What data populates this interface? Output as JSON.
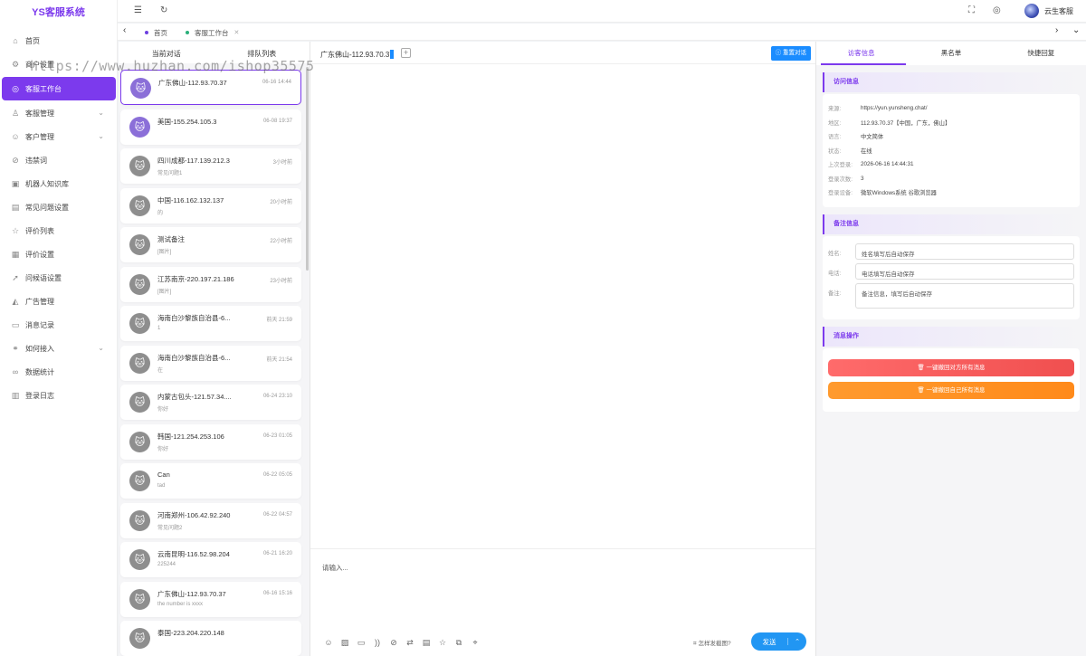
{
  "app": {
    "logo": "YS客服系统"
  },
  "sidebar": {
    "items": [
      {
        "label": "首页",
        "icon": "home-icon",
        "glyph": "⌂"
      },
      {
        "label": "商户设置",
        "icon": "gear-icon",
        "glyph": "⚙"
      },
      {
        "label": "客服工作台",
        "icon": "headset-icon",
        "glyph": "◎",
        "active": true
      },
      {
        "label": "客服管理",
        "icon": "user-icon",
        "glyph": "♙",
        "expandable": true
      },
      {
        "label": "客户管理",
        "icon": "customer-icon",
        "glyph": "☺",
        "expandable": true
      },
      {
        "label": "违禁词",
        "icon": "ban-icon",
        "glyph": "⊘"
      },
      {
        "label": "机器人知识库",
        "icon": "robot-icon",
        "glyph": "▣"
      },
      {
        "label": "常见问题设置",
        "icon": "document-icon",
        "glyph": "▤"
      },
      {
        "label": "评价列表",
        "icon": "rating-icon",
        "glyph": "☆"
      },
      {
        "label": "评价设置",
        "icon": "calendar-icon",
        "glyph": "▦"
      },
      {
        "label": "问候语设置",
        "icon": "send-icon",
        "glyph": "➚"
      },
      {
        "label": "广告管理",
        "icon": "megaphone-icon",
        "glyph": "◭"
      },
      {
        "label": "消息记录",
        "icon": "message-icon",
        "glyph": "▭"
      },
      {
        "label": "如何接入",
        "icon": "link-icon",
        "glyph": "⚭",
        "expandable": true
      },
      {
        "label": "数据统计",
        "icon": "chart-icon",
        "glyph": "∞"
      },
      {
        "label": "登录日志",
        "icon": "log-icon",
        "glyph": "▥"
      }
    ]
  },
  "topbar": {
    "username": "云生客服"
  },
  "tabs": [
    {
      "label": "首页",
      "dot_color": "#6c3fe0"
    },
    {
      "label": "客服工作台",
      "dot_color": "#2ab07a",
      "closable": true
    }
  ],
  "conversations": {
    "tabs": [
      "当前对话",
      "排队列表"
    ],
    "items": [
      {
        "name": "广东佛山-112.93.70.37",
        "time": "06-16 14:44",
        "message": "",
        "active": true,
        "avatar": "purple"
      },
      {
        "name": "美国-155.254.105.3",
        "time": "06-08 19:37",
        "message": "",
        "avatar": "purple"
      },
      {
        "name": "四川成都-117.139.212.3",
        "time": "3小时前",
        "message": "常见问题1",
        "avatar": "gray"
      },
      {
        "name": "中国-116.162.132.137",
        "time": "20小时前",
        "message": "的",
        "avatar": "gray"
      },
      {
        "name": "测试备注",
        "time": "22小时前",
        "message": "[图片]",
        "avatar": "gray"
      },
      {
        "name": "江苏南京-220.197.21.186",
        "time": "23小时前",
        "message": "[图片]",
        "avatar": "gray"
      },
      {
        "name": "海南白沙黎族自治县-6...",
        "time": "前天 21:59",
        "message": "1",
        "avatar": "gray"
      },
      {
        "name": "海南白沙黎族自治县-6...",
        "time": "前天 21:54",
        "message": "在",
        "avatar": "gray"
      },
      {
        "name": "内蒙古包头-121.57.34....",
        "time": "06-24 23:10",
        "message": "你好",
        "avatar": "gray"
      },
      {
        "name": "韩国-121.254.253.106",
        "time": "06-23 01:05",
        "message": "你好",
        "avatar": "gray"
      },
      {
        "name": "Can",
        "time": "06-22 05:05",
        "message": "tad",
        "avatar": "gray"
      },
      {
        "name": "河南郑州-106.42.92.240",
        "time": "06-22 04:57",
        "message": "常见问题2",
        "avatar": "gray"
      },
      {
        "name": "云南昆明-116.52.98.204",
        "time": "06-21 16:20",
        "message": "225244",
        "avatar": "gray"
      },
      {
        "name": "广东佛山-112.93.70.37",
        "time": "06-16 15:16",
        "message": "the number is xxxx",
        "avatar": "gray"
      },
      {
        "name": "泰国-223.204.220.148",
        "time": "",
        "message": "",
        "avatar": "gray"
      }
    ]
  },
  "chat": {
    "title": "广东佛山-112.93.70.37",
    "reset_label": "重置对话",
    "input_placeholder": "请输入...",
    "screenshot_label": "怎样发截图?",
    "send_label": "发送",
    "toolbar": [
      "emoji-icon",
      "image-icon",
      "folder-icon",
      "voice-icon",
      "block-icon",
      "shuffle-icon",
      "faq-icon",
      "star-icon",
      "translate-icon",
      "location-icon"
    ]
  },
  "rightpanel": {
    "tabs": [
      "访客信息",
      "黑名单",
      "快捷回复"
    ],
    "visit_title": "访问信息",
    "visit": [
      {
        "k": "来源:",
        "v": "https://yun.yunsheng.chat/"
      },
      {
        "k": "地区:",
        "v": "112.93.70.37【中国，广东，佛山】"
      },
      {
        "k": "语言:",
        "v": "中文简体"
      },
      {
        "k": "状态:",
        "v": "在线"
      },
      {
        "k": "上次登录:",
        "v": "2026-06-16 14:44:31"
      },
      {
        "k": "登录次数:",
        "v": "3"
      },
      {
        "k": "登录设备:",
        "v": "微软Windows系统 谷歌浏览器"
      }
    ],
    "note_title": "备注信息",
    "form": {
      "name_label": "姓名:",
      "name_placeholder": "姓名填写后自动保存",
      "phone_label": "电话:",
      "phone_placeholder": "电话填写后自动保存",
      "note_label": "备注:",
      "note_placeholder": "备注信息，填写后自动保存"
    },
    "ops_title": "消息操作",
    "btn_recall_other": "一键撤回对方所有消息",
    "btn_recall_self": "一键撤回自己所有消息"
  },
  "watermark": "https://www.huzhan.com/ishop35575"
}
